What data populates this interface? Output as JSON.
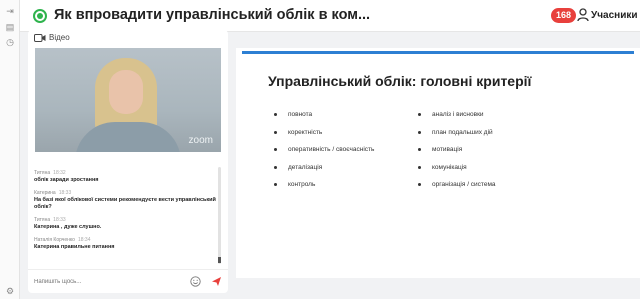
{
  "header": {
    "title": "Як впровадити управлінський облік в ком...",
    "participant_count": "168",
    "participants_label": "Учасники"
  },
  "video": {
    "label": "Відео",
    "watermark": "zoom"
  },
  "chat": {
    "messages": [
      {
        "author": "Титяна",
        "time": "18:32",
        "text": "облік заради зростання"
      },
      {
        "author": "Катерина",
        "time": "18:33",
        "text": "На базі якої облікової системи рекомендуєте вести управлінський облік?"
      },
      {
        "author": "Титяна",
        "time": "18:33",
        "text": "Катерина , дуже слушно."
      },
      {
        "author": "Наталія Корченко",
        "time": "18:34",
        "text": "Катерина правильне питання"
      }
    ],
    "input_placeholder": "Напишіть щось..."
  },
  "slide": {
    "title": "Управлінський облік: головні критерії",
    "left_items": [
      "повнота",
      "коректність",
      "оперативність / своєчасність",
      "деталізація",
      "контроль"
    ],
    "right_items": [
      "аналіз і висновки",
      "план подальших дій",
      "мотивація",
      "комунікація",
      "організація / система"
    ]
  },
  "colors": {
    "accent_blue": "#2d7fd3",
    "live_green": "#2fb34d",
    "badge_red": "#e8403c"
  },
  "icons": [
    "exit-icon",
    "document-icon",
    "clock-icon",
    "user-icon",
    "camera-icon",
    "smile-icon",
    "send-icon",
    "gear-icon"
  ]
}
